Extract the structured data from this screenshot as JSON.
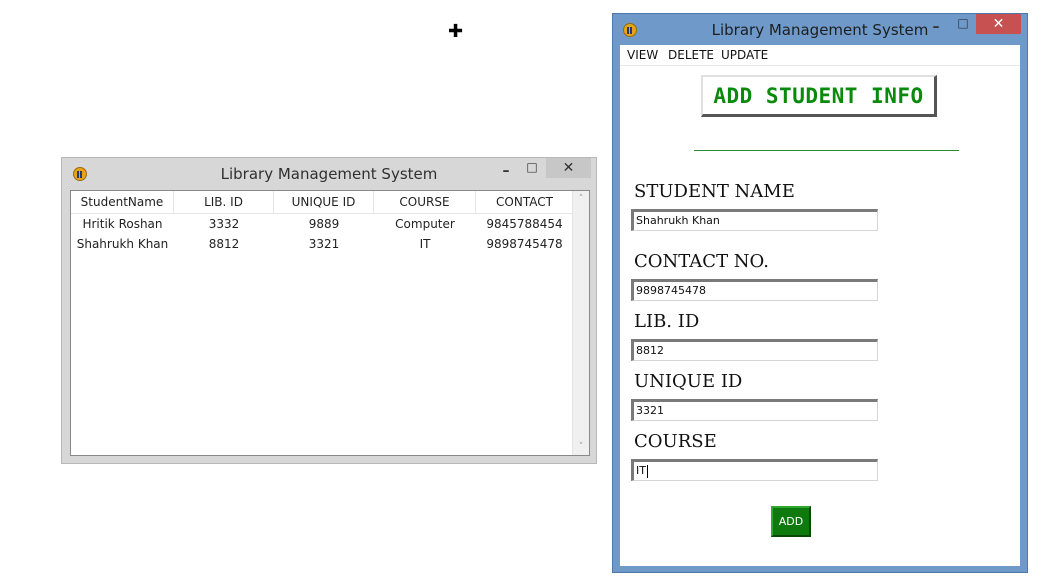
{
  "list_window": {
    "title": "Library Management System",
    "controls": {
      "minimize": "–",
      "maximize": "□",
      "close": "✕"
    },
    "columns": [
      "StudentName",
      "LIB. ID",
      "UNIQUE ID",
      "COURSE",
      "CONTACT"
    ],
    "rows": [
      [
        "Hritik Roshan",
        "3332",
        "9889",
        "Computer",
        "9845788454"
      ],
      [
        "Shahrukh Khan",
        "8812",
        "3321",
        "IT",
        "9898745478"
      ]
    ],
    "scroll_up": "˄",
    "scroll_down": "˅"
  },
  "form_window": {
    "title": "Library Management System",
    "controls": {
      "minimize": "–",
      "maximize": "□",
      "close": "✕"
    },
    "menu": {
      "view": "VIEW",
      "delete": "DELETE",
      "update": "UPDATE"
    },
    "header_button": "ADD STUDENT INFO",
    "fields": {
      "student_name": {
        "label": "STUDENT NAME",
        "value": "Shahrukh Khan"
      },
      "contact_no": {
        "label": "CONTACT NO.",
        "value": "9898745478"
      },
      "lib_id": {
        "label": "LIB. ID",
        "value": "8812"
      },
      "unique_id": {
        "label": "UNIQUE ID",
        "value": "3321"
      },
      "course": {
        "label": "COURSE",
        "value": "IT"
      }
    },
    "add_button": "ADD"
  },
  "cursor": "✚",
  "colors": {
    "form_window_frame": "#6e99c9",
    "close_button": "#c75050",
    "header_text": "#0a8a0a",
    "add_button": "#0e7a0e",
    "app_icon": "#e8a418"
  },
  "icons": {
    "app": "library-app-icon",
    "cursor": "crosshair-cursor-icon"
  }
}
